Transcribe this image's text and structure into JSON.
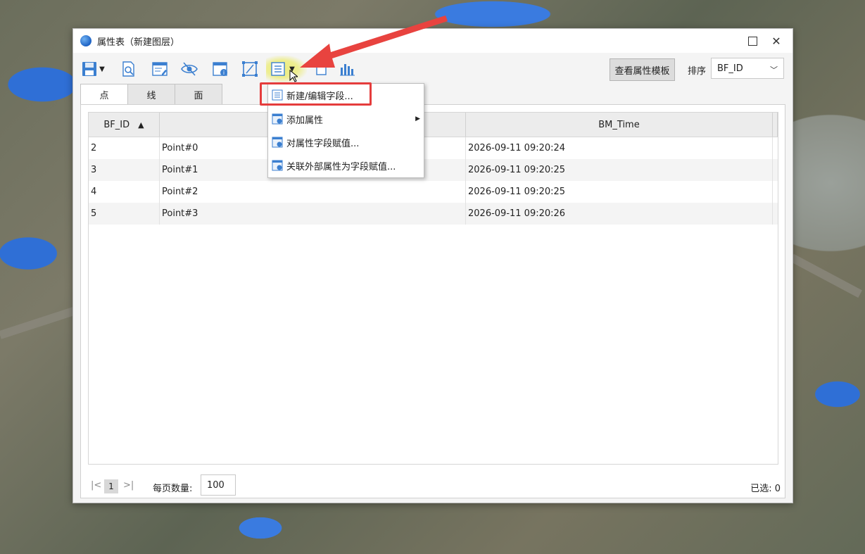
{
  "window": {
    "title": "属性表（新建图层）"
  },
  "toolbar": {
    "icons": [
      "save-icon",
      "dropdown-arrow-icon",
      "query-icon",
      "edit-form-icon",
      "hide-eye-icon",
      "field-info-icon",
      "select-box-icon",
      "field-edit-icon",
      "dropdown-arrow-icon",
      "table-copy-icon",
      "chart-icon"
    ],
    "template_button": "查看属性模板",
    "sort_label": "排序",
    "sort_value": "BF_ID"
  },
  "tabs": [
    {
      "label": "点"
    },
    {
      "label": "线"
    },
    {
      "label": "面"
    }
  ],
  "table": {
    "columns": [
      "BF_ID",
      "",
      "BM_Time"
    ],
    "rows": [
      {
        "id": "2",
        "name": "Point#0",
        "time": "2026-09-11 09:20:24"
      },
      {
        "id": "3",
        "name": "Point#1",
        "time": "2026-09-11 09:20:25"
      },
      {
        "id": "4",
        "name": "Point#2",
        "time": "2026-09-11 09:20:25"
      },
      {
        "id": "5",
        "name": "Point#3",
        "time": "2026-09-11 09:20:26"
      }
    ]
  },
  "pager": {
    "first": "|<",
    "page": "1",
    "last": ">|",
    "per_page_label": "每页数量:",
    "per_page_value": "100",
    "selected": "已选: 0"
  },
  "menu": {
    "items": [
      {
        "label": "新建/编辑字段...",
        "has_submenu": false
      },
      {
        "label": "添加属性",
        "has_submenu": true
      },
      {
        "label": "对属性字段赋值...",
        "has_submenu": false
      },
      {
        "label": "关联外部属性为字段赋值...",
        "has_submenu": false
      }
    ]
  },
  "colors": {
    "annotation_red": "#e53c3c",
    "highlight_yellow": "#ecec78",
    "accent_blue": "#1d62c4"
  }
}
